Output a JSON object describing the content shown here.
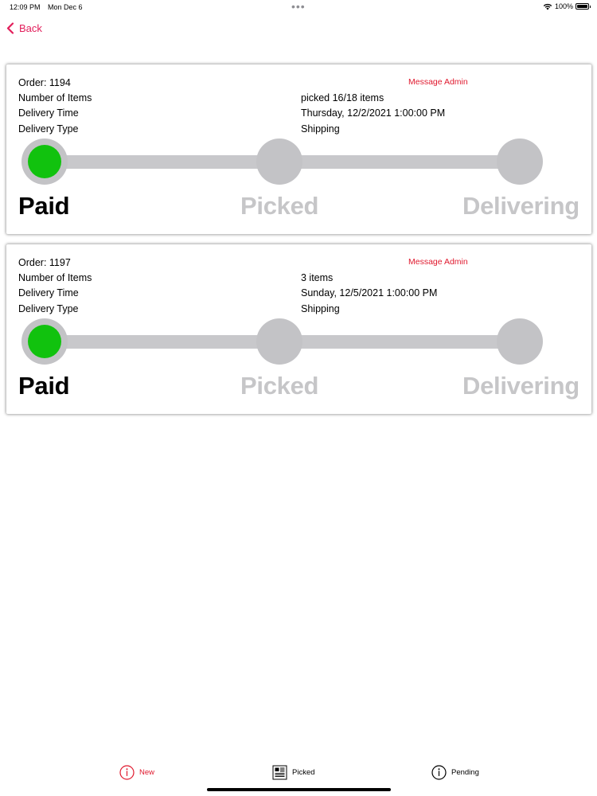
{
  "status_bar": {
    "time": "12:09 PM",
    "date": "Mon Dec 6",
    "battery": "100%"
  },
  "nav": {
    "back_label": "Back"
  },
  "orders": [
    {
      "order_label": "Order: 1194",
      "message_admin": "Message Admin",
      "items_label": "Number of Items",
      "items_value": "picked 16/18 items",
      "time_label": "Delivery Time",
      "time_value": "Thursday, 12/2/2021 1:00:00 PM",
      "type_label": "Delivery Type",
      "type_value": "Shipping",
      "steps": [
        "Paid",
        "Picked",
        "Delivering"
      ]
    },
    {
      "order_label": "Order: 1197",
      "message_admin": "Message Admin",
      "items_label": "Number of Items",
      "items_value": "3 items",
      "time_label": "Delivery Time",
      "time_value": "Sunday, 12/5/2021 1:00:00 PM",
      "type_label": "Delivery Type",
      "type_value": "Shipping",
      "steps": [
        "Paid",
        "Picked",
        "Delivering"
      ]
    }
  ],
  "tabs": [
    {
      "label": "New",
      "icon": "info-circle-icon"
    },
    {
      "label": "Picked",
      "icon": "newspaper-icon"
    },
    {
      "label": "Pending",
      "icon": "info-circle-icon"
    }
  ],
  "colors": {
    "accent": "#e21d5a",
    "alert_red": "#e0192e",
    "active_step": "#11c20e",
    "inactive_step": "#c6c6c8"
  }
}
